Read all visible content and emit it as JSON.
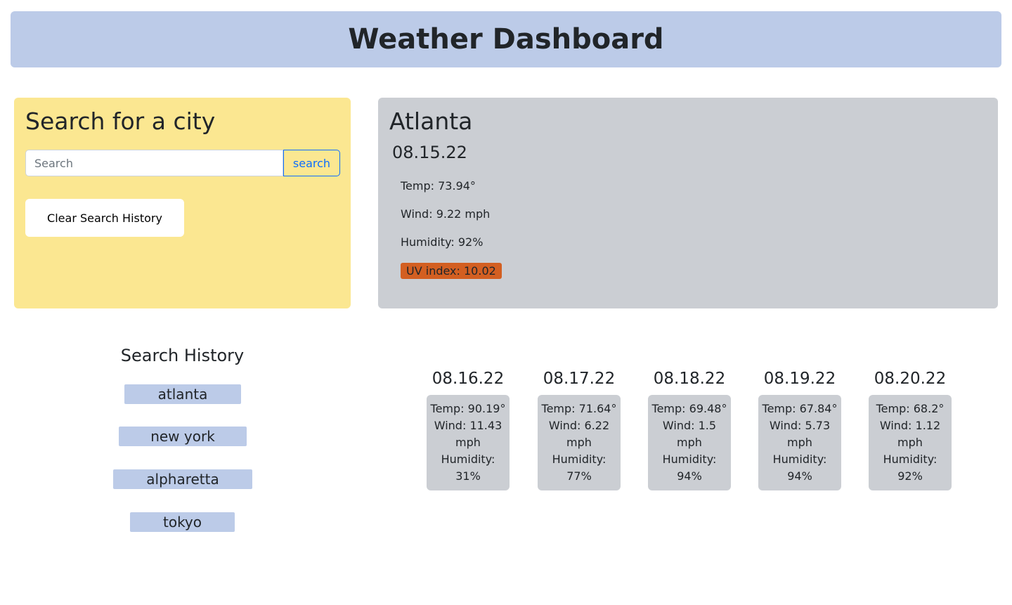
{
  "header": {
    "title": "Weather Dashboard"
  },
  "search": {
    "heading": "Search for a city",
    "placeholder": "Search",
    "button_label": "search",
    "clear_label": "Clear Search History"
  },
  "current": {
    "city": "Atlanta",
    "date": "08.15.22",
    "temp": "Temp: 73.94°",
    "wind": "Wind: 9.22 mph",
    "humidity": "Humidity: 92%",
    "uv": "UV index: 10.02",
    "uv_color": "#d35f21"
  },
  "history": {
    "title": "Search History",
    "items": [
      "atlanta",
      "new york",
      "alpharetta",
      "tokyo"
    ]
  },
  "forecast": [
    {
      "date": "08.16.22",
      "temp": "Temp: 90.19°",
      "wind": "Wind: 11.43 mph",
      "humidity": "Humidity: 31%"
    },
    {
      "date": "08.17.22",
      "temp": "Temp: 71.64°",
      "wind": "Wind: 6.22 mph",
      "humidity": "Humidity: 77%"
    },
    {
      "date": "08.18.22",
      "temp": "Temp: 69.48°",
      "wind": "Wind: 1.5 mph",
      "humidity": "Humidity: 94%"
    },
    {
      "date": "08.19.22",
      "temp": "Temp: 67.84°",
      "wind": "Wind: 5.73 mph",
      "humidity": "Humidity: 94%"
    },
    {
      "date": "08.20.22",
      "temp": "Temp: 68.2°",
      "wind": "Wind: 1.12 mph",
      "humidity": "Humidity: 92%"
    }
  ],
  "colors": {
    "header_bg": "#bccbe8",
    "search_panel_bg": "#fbe791",
    "current_panel_bg": "#cbced3",
    "accent": "#0d6efd"
  }
}
